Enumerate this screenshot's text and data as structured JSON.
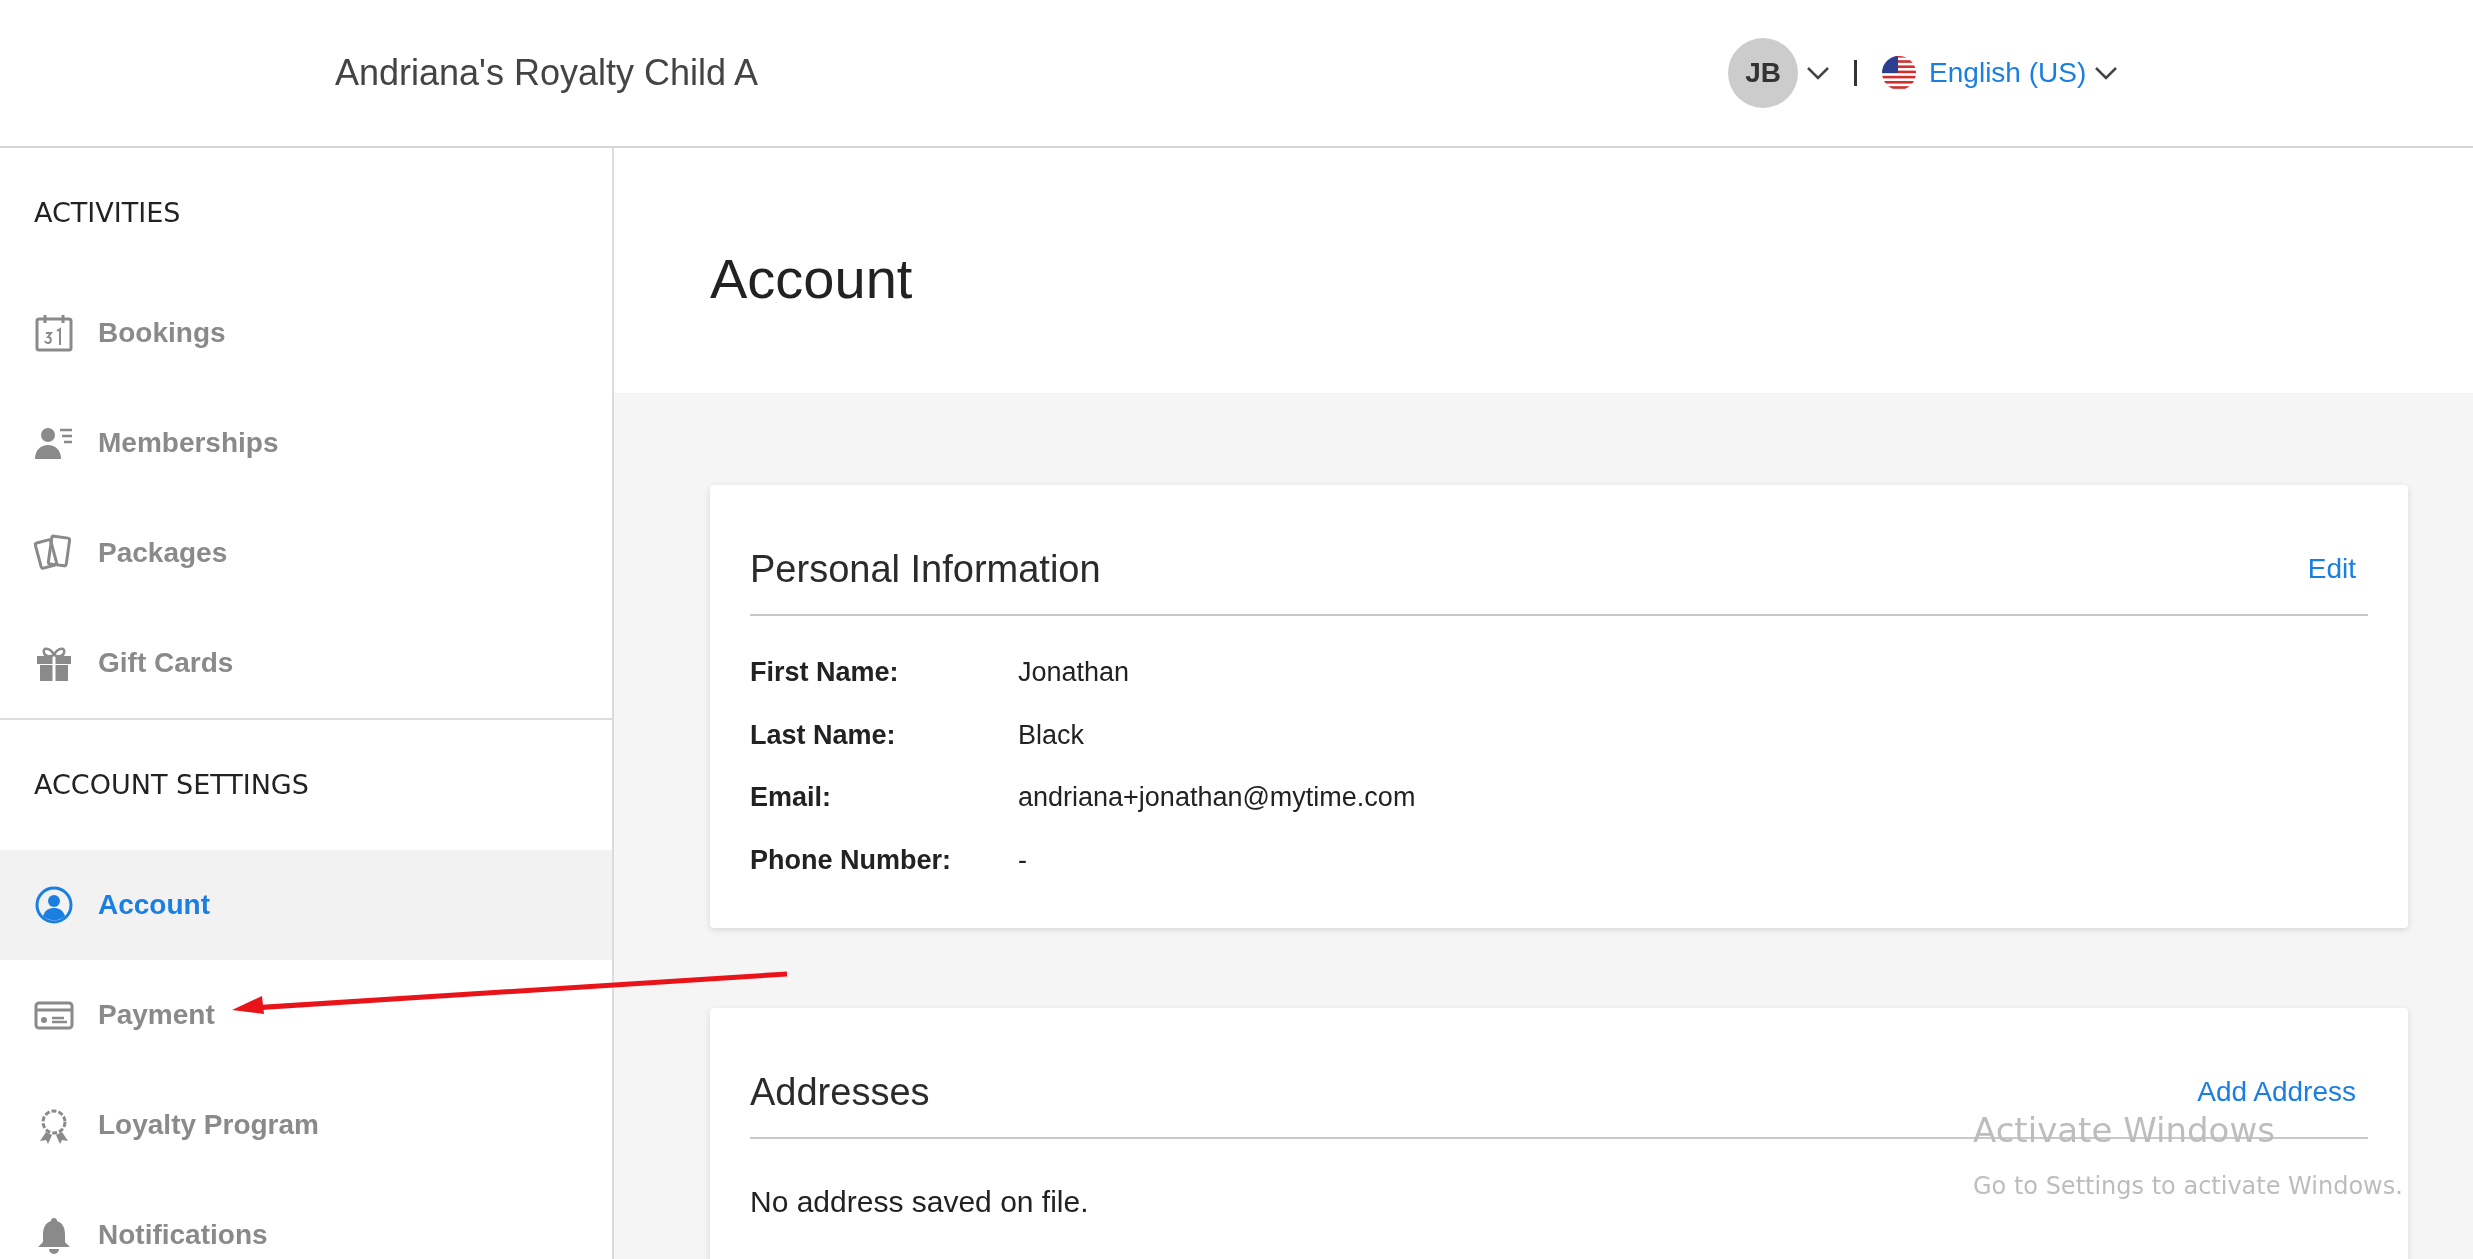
{
  "header": {
    "title": "Andriana's Royalty Child A",
    "avatar": "JB",
    "language": "English (US)"
  },
  "sidebar": {
    "sections": [
      {
        "heading": "ACTIVITIES",
        "items": [
          {
            "label": "Bookings",
            "kind": "calendar",
            "selected": false
          },
          {
            "label": "Memberships",
            "kind": "member",
            "selected": false
          },
          {
            "label": "Packages",
            "kind": "cards",
            "selected": false
          },
          {
            "label": "Gift Cards",
            "kind": "gift",
            "selected": false
          }
        ]
      },
      {
        "heading": "ACCOUNT SETTINGS",
        "items": [
          {
            "label": "Account",
            "kind": "user",
            "selected": true
          },
          {
            "label": "Payment",
            "kind": "card",
            "selected": false
          },
          {
            "label": "Loyalty Program",
            "kind": "badge",
            "selected": false
          },
          {
            "label": "Notifications",
            "kind": "bell",
            "selected": false
          }
        ]
      }
    ]
  },
  "page_title": "Account",
  "personal_info": {
    "title": "Personal Information",
    "action": "Edit",
    "fields": [
      {
        "label": "First Name:",
        "value": "Jonathan"
      },
      {
        "label": "Last Name:",
        "value": "Black"
      },
      {
        "label": "Email:",
        "value": "andriana+jonathan@mytime.com"
      },
      {
        "label": "Phone Number:",
        "value": "-"
      }
    ]
  },
  "addresses": {
    "title": "Addresses",
    "action": "Add Address",
    "empty_text": "No address saved on file."
  },
  "os_watermark": {
    "title": "Activate Windows",
    "subtitle": "Go to Settings to activate Windows."
  }
}
